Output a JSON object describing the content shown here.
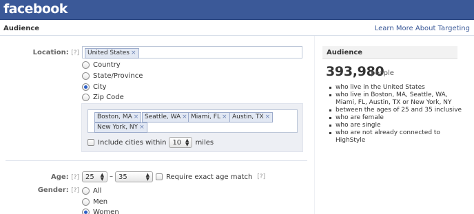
{
  "header": {
    "logo": "facebook"
  },
  "subheader": {
    "title": "Audience",
    "learn_more": "Learn More About Targeting"
  },
  "form": {
    "location": {
      "label": "Location:",
      "help": "[?]",
      "token": "United States",
      "options": [
        "Country",
        "State/Province",
        "City",
        "Zip Code"
      ],
      "selected": "City"
    },
    "cities": {
      "tokens": [
        "Boston, MA",
        "Seattle, WA",
        "Miami, FL",
        "Austin, TX",
        "New York, NY"
      ],
      "include_label": "Include cities within",
      "radius": "10",
      "unit": "miles"
    },
    "age": {
      "label": "Age:",
      "help": "[?]",
      "min": "25",
      "dash": "–",
      "max": "35",
      "exact_label": "Require exact age match",
      "exact_help": "[?]"
    },
    "gender": {
      "label": "Gender:",
      "help": "[?]",
      "options": [
        "All",
        "Men",
        "Women"
      ],
      "selected": "Women"
    }
  },
  "audience_panel": {
    "title": "Audience",
    "count": "393,980",
    "count_unit": "people",
    "criteria": [
      "who live in the United States",
      "who live in Boston, MA, Seattle, WA, Miami, FL, Austin, TX or New York, NY",
      "between the ages of 25 and 35 inclusive",
      "who are female",
      "who are single",
      "who are not already connected to HighStyle"
    ]
  },
  "colors": {
    "brand": "#3b5998",
    "link": "#3b5998",
    "token_bg": "#e2e8f3",
    "panel_bg": "#edeff4"
  },
  "icons": {
    "remove": "×",
    "select_arrows": "▲▼"
  }
}
